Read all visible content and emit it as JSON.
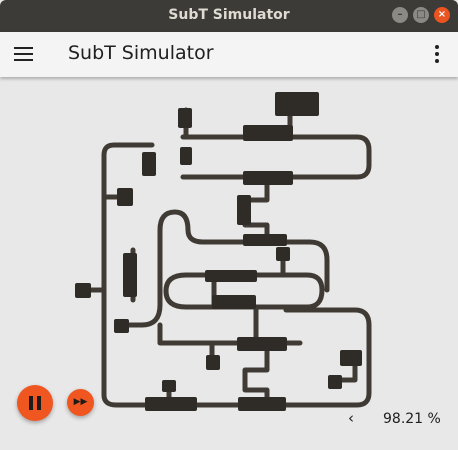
{
  "window": {
    "title": "SubT Simulator"
  },
  "appbar": {
    "title": "SubT Simulator"
  },
  "controls": {
    "ff_glyph": "▶▶",
    "chevron_glyph": "‹",
    "rtf": "98.21 %"
  },
  "icons": [
    "minimize-icon",
    "maximize-icon",
    "close-icon",
    "menu-icon",
    "more-vert-icon",
    "pause-icon",
    "fast-forward-icon",
    "chevron-left-icon"
  ],
  "colors": {
    "accent": "#f0561f",
    "tunnel": "#3f3a33",
    "background": "#e8e8e8",
    "titlebar": "#3c3b37"
  }
}
